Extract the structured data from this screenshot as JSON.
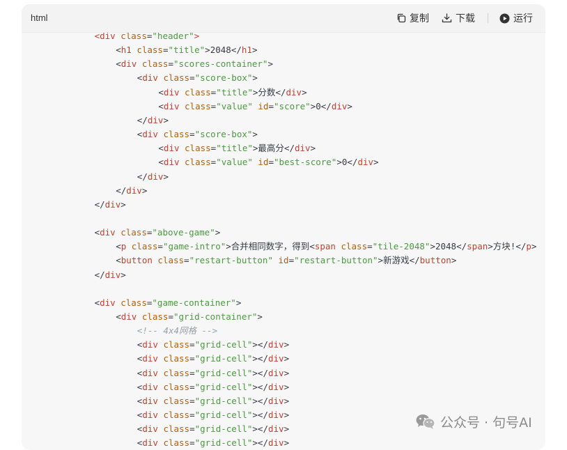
{
  "header": {
    "language": "html",
    "copy_label": "复制",
    "download_label": "下载",
    "run_label": "运行",
    "icons": [
      "copy-icon",
      "download-icon",
      "play-icon"
    ]
  },
  "code_lines": [
    {
      "indent": 4,
      "tokens": [
        {
          "k": "t",
          "v": "<div "
        },
        {
          "k": "a",
          "v": "class"
        },
        {
          "k": "p",
          "v": "="
        },
        {
          "k": "s",
          "v": "\"header\""
        },
        {
          "k": "t",
          "v": ">"
        }
      ],
      "partial": true
    },
    {
      "indent": 8,
      "tokens": [
        {
          "k": "p",
          "v": "<"
        },
        {
          "k": "t",
          "v": "h1"
        },
        {
          "k": "p",
          "v": " "
        },
        {
          "k": "a",
          "v": "class"
        },
        {
          "k": "p",
          "v": "="
        },
        {
          "k": "s",
          "v": "\"title\""
        },
        {
          "k": "p",
          "v": ">"
        },
        {
          "k": "x",
          "v": "2048"
        },
        {
          "k": "p",
          "v": "</"
        },
        {
          "k": "t",
          "v": "h1"
        },
        {
          "k": "p",
          "v": ">"
        }
      ]
    },
    {
      "indent": 8,
      "tokens": [
        {
          "k": "p",
          "v": "<"
        },
        {
          "k": "t",
          "v": "div"
        },
        {
          "k": "p",
          "v": " "
        },
        {
          "k": "a",
          "v": "class"
        },
        {
          "k": "p",
          "v": "="
        },
        {
          "k": "s",
          "v": "\"scores-container\""
        },
        {
          "k": "p",
          "v": ">"
        }
      ]
    },
    {
      "indent": 12,
      "tokens": [
        {
          "k": "p",
          "v": "<"
        },
        {
          "k": "t",
          "v": "div"
        },
        {
          "k": "p",
          "v": " "
        },
        {
          "k": "a",
          "v": "class"
        },
        {
          "k": "p",
          "v": "="
        },
        {
          "k": "s",
          "v": "\"score-box\""
        },
        {
          "k": "p",
          "v": ">"
        }
      ]
    },
    {
      "indent": 16,
      "tokens": [
        {
          "k": "p",
          "v": "<"
        },
        {
          "k": "t",
          "v": "div"
        },
        {
          "k": "p",
          "v": " "
        },
        {
          "k": "a",
          "v": "class"
        },
        {
          "k": "p",
          "v": "="
        },
        {
          "k": "s",
          "v": "\"title\""
        },
        {
          "k": "p",
          "v": ">"
        },
        {
          "k": "x",
          "v": "分数"
        },
        {
          "k": "p",
          "v": "</"
        },
        {
          "k": "t",
          "v": "div"
        },
        {
          "k": "p",
          "v": ">"
        }
      ]
    },
    {
      "indent": 16,
      "tokens": [
        {
          "k": "p",
          "v": "<"
        },
        {
          "k": "t",
          "v": "div"
        },
        {
          "k": "p",
          "v": " "
        },
        {
          "k": "a",
          "v": "class"
        },
        {
          "k": "p",
          "v": "="
        },
        {
          "k": "s",
          "v": "\"value\""
        },
        {
          "k": "p",
          "v": " "
        },
        {
          "k": "a",
          "v": "id"
        },
        {
          "k": "p",
          "v": "="
        },
        {
          "k": "s",
          "v": "\"score\""
        },
        {
          "k": "p",
          "v": ">"
        },
        {
          "k": "x",
          "v": "0"
        },
        {
          "k": "p",
          "v": "</"
        },
        {
          "k": "t",
          "v": "div"
        },
        {
          "k": "p",
          "v": ">"
        }
      ]
    },
    {
      "indent": 12,
      "tokens": [
        {
          "k": "p",
          "v": "</"
        },
        {
          "k": "t",
          "v": "div"
        },
        {
          "k": "p",
          "v": ">"
        }
      ]
    },
    {
      "indent": 12,
      "tokens": [
        {
          "k": "p",
          "v": "<"
        },
        {
          "k": "t",
          "v": "div"
        },
        {
          "k": "p",
          "v": " "
        },
        {
          "k": "a",
          "v": "class"
        },
        {
          "k": "p",
          "v": "="
        },
        {
          "k": "s",
          "v": "\"score-box\""
        },
        {
          "k": "p",
          "v": ">"
        }
      ]
    },
    {
      "indent": 16,
      "tokens": [
        {
          "k": "p",
          "v": "<"
        },
        {
          "k": "t",
          "v": "div"
        },
        {
          "k": "p",
          "v": " "
        },
        {
          "k": "a",
          "v": "class"
        },
        {
          "k": "p",
          "v": "="
        },
        {
          "k": "s",
          "v": "\"title\""
        },
        {
          "k": "p",
          "v": ">"
        },
        {
          "k": "x",
          "v": "最高分"
        },
        {
          "k": "p",
          "v": "</"
        },
        {
          "k": "t",
          "v": "div"
        },
        {
          "k": "p",
          "v": ">"
        }
      ]
    },
    {
      "indent": 16,
      "tokens": [
        {
          "k": "p",
          "v": "<"
        },
        {
          "k": "t",
          "v": "div"
        },
        {
          "k": "p",
          "v": " "
        },
        {
          "k": "a",
          "v": "class"
        },
        {
          "k": "p",
          "v": "="
        },
        {
          "k": "s",
          "v": "\"value\""
        },
        {
          "k": "p",
          "v": " "
        },
        {
          "k": "a",
          "v": "id"
        },
        {
          "k": "p",
          "v": "="
        },
        {
          "k": "s",
          "v": "\"best-score\""
        },
        {
          "k": "p",
          "v": ">"
        },
        {
          "k": "x",
          "v": "0"
        },
        {
          "k": "p",
          "v": "</"
        },
        {
          "k": "t",
          "v": "div"
        },
        {
          "k": "p",
          "v": ">"
        }
      ]
    },
    {
      "indent": 12,
      "tokens": [
        {
          "k": "p",
          "v": "</"
        },
        {
          "k": "t",
          "v": "div"
        },
        {
          "k": "p",
          "v": ">"
        }
      ]
    },
    {
      "indent": 8,
      "tokens": [
        {
          "k": "p",
          "v": "</"
        },
        {
          "k": "t",
          "v": "div"
        },
        {
          "k": "p",
          "v": ">"
        }
      ]
    },
    {
      "indent": 4,
      "tokens": [
        {
          "k": "p",
          "v": "</"
        },
        {
          "k": "t",
          "v": "div"
        },
        {
          "k": "p",
          "v": ">"
        }
      ]
    },
    {
      "indent": 0,
      "tokens": []
    },
    {
      "indent": 4,
      "tokens": [
        {
          "k": "p",
          "v": "<"
        },
        {
          "k": "t",
          "v": "div"
        },
        {
          "k": "p",
          "v": " "
        },
        {
          "k": "a",
          "v": "class"
        },
        {
          "k": "p",
          "v": "="
        },
        {
          "k": "s",
          "v": "\"above-game\""
        },
        {
          "k": "p",
          "v": ">"
        }
      ]
    },
    {
      "indent": 8,
      "tokens": [
        {
          "k": "p",
          "v": "<"
        },
        {
          "k": "t",
          "v": "p"
        },
        {
          "k": "p",
          "v": " "
        },
        {
          "k": "a",
          "v": "class"
        },
        {
          "k": "p",
          "v": "="
        },
        {
          "k": "s",
          "v": "\"game-intro\""
        },
        {
          "k": "p",
          "v": ">"
        },
        {
          "k": "x",
          "v": "合并相同数字，得到"
        },
        {
          "k": "p",
          "v": "<"
        },
        {
          "k": "t",
          "v": "span"
        },
        {
          "k": "p",
          "v": " "
        },
        {
          "k": "a",
          "v": "class"
        },
        {
          "k": "p",
          "v": "="
        },
        {
          "k": "s",
          "v": "\"tile-2048\""
        },
        {
          "k": "p",
          "v": ">"
        },
        {
          "k": "x",
          "v": "2048"
        },
        {
          "k": "p",
          "v": "</"
        },
        {
          "k": "t",
          "v": "span"
        },
        {
          "k": "p",
          "v": ">"
        },
        {
          "k": "x",
          "v": "方块!"
        },
        {
          "k": "p",
          "v": "</"
        },
        {
          "k": "t",
          "v": "p"
        },
        {
          "k": "p",
          "v": ">"
        }
      ]
    },
    {
      "indent": 8,
      "tokens": [
        {
          "k": "p",
          "v": "<"
        },
        {
          "k": "t",
          "v": "button"
        },
        {
          "k": "p",
          "v": " "
        },
        {
          "k": "a",
          "v": "class"
        },
        {
          "k": "p",
          "v": "="
        },
        {
          "k": "s",
          "v": "\"restart-button\""
        },
        {
          "k": "p",
          "v": " "
        },
        {
          "k": "a",
          "v": "id"
        },
        {
          "k": "p",
          "v": "="
        },
        {
          "k": "s",
          "v": "\"restart-button\""
        },
        {
          "k": "p",
          "v": ">"
        },
        {
          "k": "x",
          "v": "新游戏"
        },
        {
          "k": "p",
          "v": "</"
        },
        {
          "k": "t",
          "v": "button"
        },
        {
          "k": "p",
          "v": ">"
        }
      ]
    },
    {
      "indent": 4,
      "tokens": [
        {
          "k": "p",
          "v": "</"
        },
        {
          "k": "t",
          "v": "div"
        },
        {
          "k": "p",
          "v": ">"
        }
      ]
    },
    {
      "indent": 0,
      "tokens": []
    },
    {
      "indent": 4,
      "tokens": [
        {
          "k": "p",
          "v": "<"
        },
        {
          "k": "t",
          "v": "div"
        },
        {
          "k": "p",
          "v": " "
        },
        {
          "k": "a",
          "v": "class"
        },
        {
          "k": "p",
          "v": "="
        },
        {
          "k": "s",
          "v": "\"game-container\""
        },
        {
          "k": "p",
          "v": ">"
        }
      ]
    },
    {
      "indent": 8,
      "tokens": [
        {
          "k": "p",
          "v": "<"
        },
        {
          "k": "t",
          "v": "div"
        },
        {
          "k": "p",
          "v": " "
        },
        {
          "k": "a",
          "v": "class"
        },
        {
          "k": "p",
          "v": "="
        },
        {
          "k": "s",
          "v": "\"grid-container\""
        },
        {
          "k": "p",
          "v": ">"
        }
      ]
    },
    {
      "indent": 12,
      "tokens": [
        {
          "k": "c",
          "v": "<!-- 4x4网格 -->"
        }
      ]
    },
    {
      "indent": 12,
      "tokens": [
        {
          "k": "p",
          "v": "<"
        },
        {
          "k": "t",
          "v": "div"
        },
        {
          "k": "p",
          "v": " "
        },
        {
          "k": "a",
          "v": "class"
        },
        {
          "k": "p",
          "v": "="
        },
        {
          "k": "s",
          "v": "\"grid-cell\""
        },
        {
          "k": "p",
          "v": "></"
        },
        {
          "k": "t",
          "v": "div"
        },
        {
          "k": "p",
          "v": ">"
        }
      ]
    },
    {
      "indent": 12,
      "tokens": [
        {
          "k": "p",
          "v": "<"
        },
        {
          "k": "t",
          "v": "div"
        },
        {
          "k": "p",
          "v": " "
        },
        {
          "k": "a",
          "v": "class"
        },
        {
          "k": "p",
          "v": "="
        },
        {
          "k": "s",
          "v": "\"grid-cell\""
        },
        {
          "k": "p",
          "v": "></"
        },
        {
          "k": "t",
          "v": "div"
        },
        {
          "k": "p",
          "v": ">"
        }
      ]
    },
    {
      "indent": 12,
      "tokens": [
        {
          "k": "p",
          "v": "<"
        },
        {
          "k": "t",
          "v": "div"
        },
        {
          "k": "p",
          "v": " "
        },
        {
          "k": "a",
          "v": "class"
        },
        {
          "k": "p",
          "v": "="
        },
        {
          "k": "s",
          "v": "\"grid-cell\""
        },
        {
          "k": "p",
          "v": "></"
        },
        {
          "k": "t",
          "v": "div"
        },
        {
          "k": "p",
          "v": ">"
        }
      ]
    },
    {
      "indent": 12,
      "tokens": [
        {
          "k": "p",
          "v": "<"
        },
        {
          "k": "t",
          "v": "div"
        },
        {
          "k": "p",
          "v": " "
        },
        {
          "k": "a",
          "v": "class"
        },
        {
          "k": "p",
          "v": "="
        },
        {
          "k": "s",
          "v": "\"grid-cell\""
        },
        {
          "k": "p",
          "v": "></"
        },
        {
          "k": "t",
          "v": "div"
        },
        {
          "k": "p",
          "v": ">"
        }
      ]
    },
    {
      "indent": 12,
      "tokens": [
        {
          "k": "p",
          "v": "<"
        },
        {
          "k": "t",
          "v": "div"
        },
        {
          "k": "p",
          "v": " "
        },
        {
          "k": "a",
          "v": "class"
        },
        {
          "k": "p",
          "v": "="
        },
        {
          "k": "s",
          "v": "\"grid-cell\""
        },
        {
          "k": "p",
          "v": "></"
        },
        {
          "k": "t",
          "v": "div"
        },
        {
          "k": "p",
          "v": ">"
        }
      ]
    },
    {
      "indent": 12,
      "tokens": [
        {
          "k": "p",
          "v": "<"
        },
        {
          "k": "t",
          "v": "div"
        },
        {
          "k": "p",
          "v": " "
        },
        {
          "k": "a",
          "v": "class"
        },
        {
          "k": "p",
          "v": "="
        },
        {
          "k": "s",
          "v": "\"grid-cell\""
        },
        {
          "k": "p",
          "v": "></"
        },
        {
          "k": "t",
          "v": "div"
        },
        {
          "k": "p",
          "v": ">"
        }
      ]
    },
    {
      "indent": 12,
      "tokens": [
        {
          "k": "p",
          "v": "<"
        },
        {
          "k": "t",
          "v": "div"
        },
        {
          "k": "p",
          "v": " "
        },
        {
          "k": "a",
          "v": "class"
        },
        {
          "k": "p",
          "v": "="
        },
        {
          "k": "s",
          "v": "\"grid-cell\""
        },
        {
          "k": "p",
          "v": "></"
        },
        {
          "k": "t",
          "v": "div"
        },
        {
          "k": "p",
          "v": ">"
        }
      ]
    },
    {
      "indent": 12,
      "tokens": [
        {
          "k": "p",
          "v": "<"
        },
        {
          "k": "t",
          "v": "div"
        },
        {
          "k": "p",
          "v": " "
        },
        {
          "k": "a",
          "v": "class"
        },
        {
          "k": "p",
          "v": "="
        },
        {
          "k": "s",
          "v": "\"grid-cell\""
        },
        {
          "k": "p",
          "v": "></"
        },
        {
          "k": "t",
          "v": "div"
        },
        {
          "k": "p",
          "v": ">"
        }
      ]
    }
  ],
  "watermark": {
    "text": "公众号 · 句号AI",
    "icon": "wechat-icon"
  },
  "colors": {
    "tag": "#c5402f",
    "attribute": "#b45f09",
    "string": "#4b9a3f",
    "comment": "#9aa0a6",
    "text": "#383a42"
  }
}
